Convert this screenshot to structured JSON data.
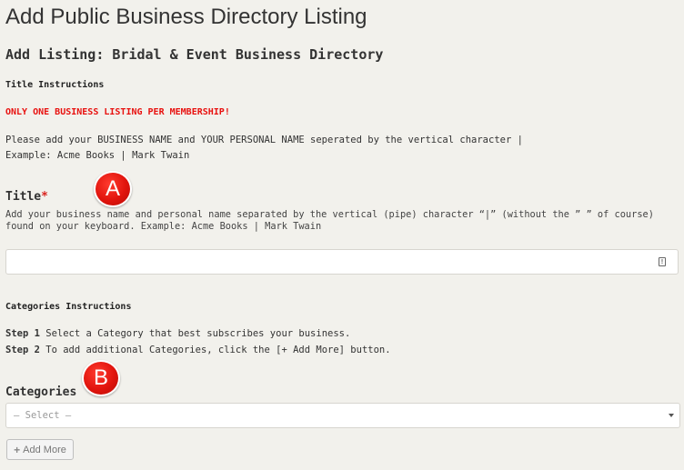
{
  "page_title": "Add Public Business Directory Listing",
  "subtitle": "Add Listing: Bridal & Event Business Directory",
  "title_instructions": {
    "heading": "Title Instructions",
    "warning": "ONLY ONE BUSINESS LISTING PER MEMBERSHIP!",
    "line1": "Please add your BUSINESS NAME and YOUR PERSONAL NAME seperated by the vertical character |",
    "line2": "Example: Acme Books | Mark Twain"
  },
  "title_field": {
    "label": "Title",
    "required_mark": "*",
    "help": "Add your business name and personal name separated by the vertical (pipe) character “|” (without the ” ” of course) found on your keyboard. Example: Acme Books | Mark Twain",
    "value": "",
    "icon": "info-card-icon"
  },
  "categories_instructions": {
    "heading": "Categories Instructions",
    "step1_label": "Step 1",
    "step1_text": " Select a Category that best subscribes your business.",
    "step2_label": "Step 2",
    "step2_text": " To add additional Categories, click the [+ Add More] button."
  },
  "categories_field": {
    "label": "Categories",
    "selected": "— Select —"
  },
  "add_more": {
    "plus": "+",
    "label": "Add More"
  },
  "markers": {
    "a": "A",
    "b": "B",
    "color": "#e1140d"
  }
}
